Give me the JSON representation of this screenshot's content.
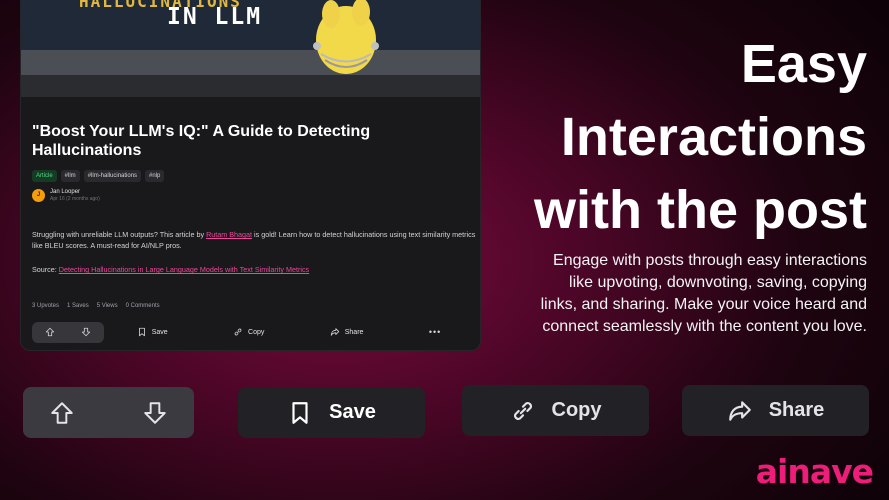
{
  "hero": {
    "title_top": "HALLUCINATIONS",
    "title_main": "IN LLM"
  },
  "post": {
    "title": "\"Boost Your LLM's IQ:\" A Guide to Detecting Hallucinations",
    "tags": [
      "Article",
      "#llm",
      "#llm-hallucinations",
      "#nlp"
    ],
    "author_name": "Jan Looper",
    "author_initial": "J",
    "author_date": "Apr 16 (2 months ago)",
    "body_before_link": "Struggling with unreliable LLM outputs? This article by ",
    "body_link": "Rutam Bhagat",
    "body_after_link": " is gold! Learn how to detect hallucinations using text similarity metrics like BLEU scores. A must-read for AI/NLP pros.",
    "source_label": "Source: ",
    "source_link": "Detecting Hallucinations in Large Language Models with Text Similarity Metrics",
    "stats": {
      "upvotes": "3 Upvotes",
      "saves": "1 Saves",
      "views": "5 Views",
      "comments": "0 Comments"
    },
    "actions": {
      "save": "Save",
      "copy": "Copy",
      "share": "Share",
      "more": "•••"
    }
  },
  "headline": {
    "line1": "Easy",
    "line2": "Interactions",
    "line3": "with the post"
  },
  "subtext": "Engage with posts through easy interactions like upvoting, downvoting, saving, copying links, and sharing. Make your voice heard and connect seamlessly with the content you love.",
  "big_buttons": {
    "save": "Save",
    "copy": "Copy",
    "share": "Share"
  },
  "logo": "ainave",
  "icons": [
    "upvote-icon",
    "downvote-icon",
    "bookmark-icon",
    "link-icon",
    "share-icon",
    "more-icon"
  ],
  "colors": {
    "accent": "#ec1e79",
    "link": "#ec4899",
    "tag_article": "#4ade80"
  }
}
